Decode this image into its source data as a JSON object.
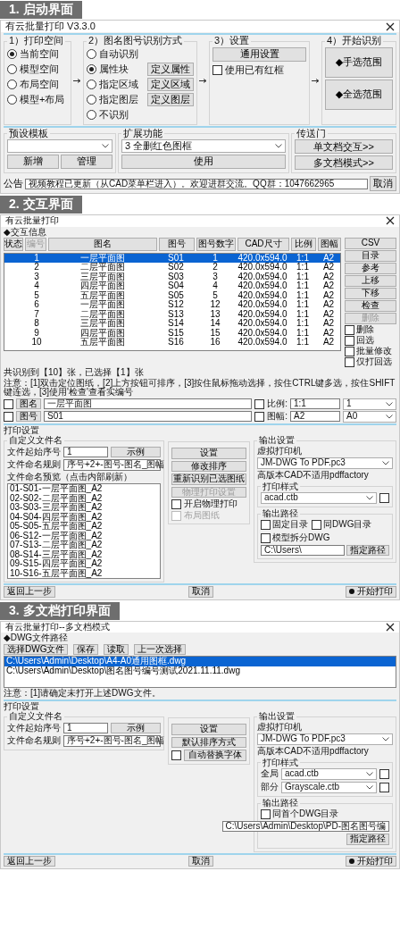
{
  "launch": {
    "banner": "1. 启动界面",
    "title": "有云批量打印 V3.3.0",
    "print_space": {
      "title": "1）打印空间",
      "options": [
        {
          "label": "当前空间",
          "selected": true
        },
        {
          "label": "模型空间",
          "selected": false
        },
        {
          "label": "布局空间",
          "selected": false
        },
        {
          "label": "模型+布局",
          "selected": false
        }
      ]
    },
    "recognition": {
      "title": "2）图名图号识别方式",
      "options": [
        {
          "label": "自动识别",
          "selected": false
        },
        {
          "label": "属性块",
          "selected": true,
          "button": "定义属性"
        },
        {
          "label": "指定区域",
          "selected": false,
          "button": "定义区域"
        },
        {
          "label": "指定图层",
          "selected": false,
          "button": "定义图层"
        },
        {
          "label": "不识别",
          "selected": false
        }
      ]
    },
    "settings": {
      "title": "3）设置",
      "button": "通用设置",
      "checkbox": {
        "label": "使用已有红框",
        "checked": false
      }
    },
    "start": {
      "title": "4）开始识别",
      "buttons": [
        "◆手选范围",
        "◆全选范围"
      ]
    },
    "presets": {
      "title": "预设模板",
      "buttons": [
        "新增",
        "管理"
      ]
    },
    "extensions": {
      "title": "扩展功能",
      "select": "3 全删红色图框",
      "button": "使用"
    },
    "portal": {
      "title": "传送门",
      "buttons": [
        "单文档交互>>",
        "多文档模式>>"
      ]
    },
    "notice": {
      "label": "公告",
      "value": "视频教程已更新（从CAD菜单栏进入）。欢迎进群交流。QQ群：1047662965",
      "button": "取消"
    }
  },
  "interactive": {
    "banner": "2. 交互界面",
    "title": "有云批量打印",
    "group": "◆交互信息",
    "columns": [
      {
        "label": "状态",
        "disabled": false
      },
      {
        "label": "编号",
        "disabled": true
      },
      {
        "label": "图名",
        "disabled": false
      },
      {
        "label": "图号",
        "disabled": false
      },
      {
        "label": "图号数字",
        "disabled": false
      },
      {
        "label": "CAD尺寸",
        "disabled": false
      },
      {
        "label": "比例",
        "disabled": false
      },
      {
        "label": "图幅",
        "disabled": false
      }
    ],
    "rows": [
      {
        "cells": [
          "",
          "1",
          "一层平面图",
          "S01",
          "1",
          "420.0x594.0",
          "1:1",
          "A2"
        ],
        "selected": true
      },
      {
        "cells": [
          "",
          "2",
          "二层平面图",
          "S02",
          "2",
          "420.0x594.0",
          "1:1",
          "A2"
        ],
        "selected": false
      },
      {
        "cells": [
          "",
          "3",
          "三层平面图",
          "S03",
          "3",
          "420.0x594.0",
          "1:1",
          "A2"
        ],
        "selected": false
      },
      {
        "cells": [
          "",
          "4",
          "四层平面图",
          "S04",
          "4",
          "420.0x594.0",
          "1:1",
          "A2"
        ],
        "selected": false
      },
      {
        "cells": [
          "",
          "5",
          "五层平面图",
          "S05",
          "5",
          "420.0x594.0",
          "1:1",
          "A2"
        ],
        "selected": false
      },
      {
        "cells": [
          "",
          "6",
          "一层平面图",
          "S12",
          "12",
          "420.0x594.0",
          "1:1",
          "A2"
        ],
        "selected": false
      },
      {
        "cells": [
          "",
          "7",
          "二层平面图",
          "S13",
          "13",
          "420.0x594.0",
          "1:1",
          "A2"
        ],
        "selected": false
      },
      {
        "cells": [
          "",
          "8",
          "三层平面图",
          "S14",
          "14",
          "420.0x594.0",
          "1:1",
          "A2"
        ],
        "selected": false
      },
      {
        "cells": [
          "",
          "9",
          "四层平面图",
          "S15",
          "15",
          "420.0x594.0",
          "1:1",
          "A2"
        ],
        "selected": false
      },
      {
        "cells": [
          "",
          "10",
          "五层平面图",
          "S16",
          "16",
          "420.0x594.0",
          "1:1",
          "A2"
        ],
        "selected": false
      }
    ],
    "side_buttons": [
      {
        "label": "CSV",
        "disabled": false
      },
      {
        "label": "目录",
        "disabled": false
      },
      {
        "label": "参考",
        "disabled": false
      },
      {
        "label": "上移",
        "disabled": false
      },
      {
        "label": "下移",
        "disabled": false
      },
      {
        "label": "检查",
        "disabled": false
      },
      {
        "label": "删除",
        "disabled": true
      }
    ],
    "side_checks": [
      {
        "label": "删除",
        "checked": false
      },
      {
        "label": "回选",
        "checked": false
      },
      {
        "label": "批量修改",
        "checked": false
      },
      {
        "label": "仅打回选",
        "checked": false
      }
    ],
    "status": "共识别到【10】张，已选择【1】张",
    "note": "注意：[1]双击定位图纸，[2]上方按钮可排序，[3]按住鼠标拖动选择，按住CTRL键多选，按住SHIFT键连选，[3]使用'检查'查看实编号",
    "edit_rows": [
      {
        "checked": false,
        "button": "图名",
        "value": "一层平面图",
        "checked2": false,
        "label": "比例:",
        "value2": "1:1",
        "select": "1"
      },
      {
        "checked": false,
        "button": "图号",
        "value": "S01",
        "checked2": false,
        "label": "图幅:",
        "value2": "A2",
        "select": "A0"
      }
    ],
    "print": {
      "title": "打印设置",
      "naming_title": "自定义文件名",
      "start_label": "文件起始序号",
      "start_value": "1",
      "example": "示例",
      "rule_label": "文件命名规则",
      "rule_value": "序号+2+-图号-图名_图幅",
      "preview_label": "文件命名预览（点击内部刷新）",
      "preview": [
        "01-S01-一层平面图_A2",
        "02-S02-二层平面图_A2",
        "03-S03-三层平面图_A2",
        "04-S04-四层平面图_A2",
        "05-S05-五层平面图_A2",
        "06-S12-一层平面图_A2",
        "07-S13-二层平面图_A2",
        "08-S14-三层平面图_A2",
        "09-S15-四层平面图_A2",
        "10-S16-五层平面图_A2"
      ],
      "actions": [
        {
          "kind": "button",
          "label": "设置",
          "disabled": false
        },
        {
          "kind": "button",
          "label": "修改排序",
          "disabled": false
        },
        {
          "kind": "button",
          "label": "重新识别已选图纸",
          "disabled": false
        },
        {
          "kind": "button",
          "label": "物理打印设置",
          "disabled": true
        },
        {
          "kind": "check",
          "label": "开启物理打印",
          "checked": false,
          "disabled": false
        },
        {
          "kind": "check",
          "label": "布局图纸",
          "checked": false,
          "disabled": true
        }
      ],
      "output": {
        "title": "输出设置",
        "printer_title": "虚拟打印机",
        "printer": "JM-DWG To PDF.pc3",
        "printer_note": "高版本CAD不适用pdffactory",
        "style_title": "打印样式",
        "styles": [
          {
            "value": "acad.ctb",
            "checked": false
          }
        ],
        "path_title": "输出路径",
        "path_checks": [
          {
            "label": "固定目录",
            "checked": false
          },
          {
            "label": "同DWG目录",
            "checked": false
          },
          {
            "label": "模型拆分DWG",
            "checked": false
          }
        ],
        "path": "C:\\Users\\",
        "path_button": "指定路径"
      }
    },
    "footer": [
      "返回上一步",
      "取消",
      "开始打印"
    ]
  },
  "multi": {
    "banner": "3. 多文档打印界面",
    "title": "有云批量打印--多文档模式",
    "group": "◆DWG文件路径",
    "buttons": [
      "选择DWG文件",
      "保存",
      "读取",
      "上一次选择"
    ],
    "files": [
      {
        "path": "C:\\Users\\Admin\\Desktop\\A4-A0通用图框.dwg",
        "selected": true
      },
      {
        "path": "C:\\Users\\Admin\\Desktop\\图名图号编号测试2021.11.11.dwg",
        "selected": false
      }
    ],
    "note": "注意：[1]请确定未打开上述DWG文件。",
    "print": {
      "title": "打印设置",
      "naming_title": "自定义文件名",
      "start_label": "文件起始序号",
      "start_value": "1",
      "example": "示例",
      "rule_label": "文件命名规则",
      "rule_value": "序号+2+-图号-图名_图幅",
      "actions": [
        {
          "kind": "button",
          "label": "设置",
          "disabled": false
        },
        {
          "kind": "button",
          "label": "默认排序方式",
          "disabled": false
        },
        {
          "kind": "check_button",
          "label": "自动替换字体",
          "checked": false
        }
      ],
      "output": {
        "title": "输出设置",
        "printer_title": "虚拟打印机",
        "printer": "JM-DWG To PDF.pc3",
        "printer_note": "高版本CAD不适用pdffactory",
        "style_title": "打印样式",
        "styles": [
          {
            "label": "全局",
            "value": "acad.ctb",
            "checked": false
          },
          {
            "label": "部分",
            "value": "Grayscale.ctb",
            "checked": false
          }
        ],
        "path_title": "输出路径",
        "path_checks": [
          {
            "label": "同首个DWG目录",
            "checked": false
          }
        ],
        "path": "C:\\Users\\Admin\\Desktop\\PD-图名图号编",
        "path_button": "指定路径"
      }
    },
    "footer": [
      "返回上一步",
      "取消",
      "开始打印"
    ]
  }
}
